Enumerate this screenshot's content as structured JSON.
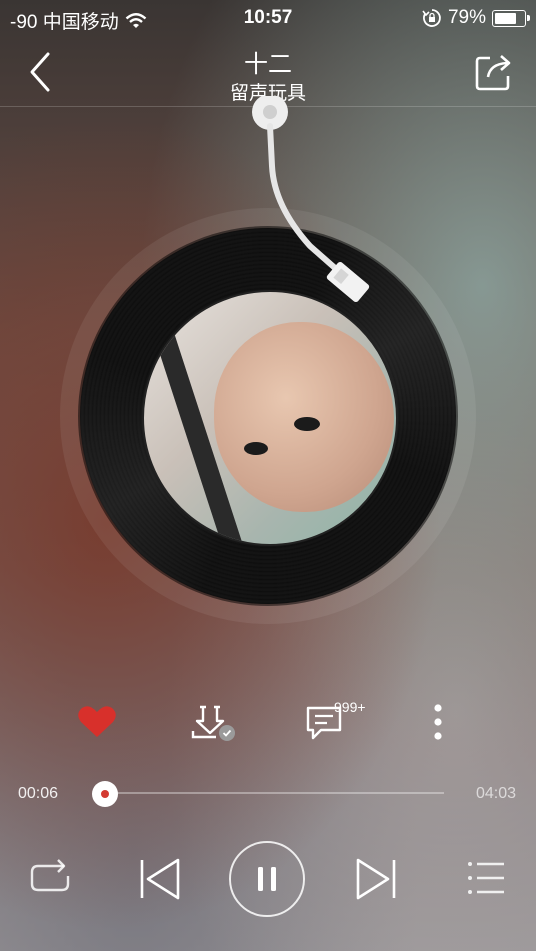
{
  "status_bar": {
    "carrier": "-90 中国移动",
    "time": "10:57",
    "battery_text": "79%",
    "battery_level": 0.79,
    "icons": [
      "wifi-icon",
      "rotation-lock-icon",
      "battery-icon"
    ]
  },
  "header": {
    "title": "十二",
    "artist": "留声玩具",
    "back_icon": "chevron-left-icon",
    "share_icon": "share-icon"
  },
  "player": {
    "album_art": "album-cover",
    "liked": true,
    "like_color": "#d8302b",
    "comment_count": "999+",
    "current_time": "00:06",
    "total_time": "04:03",
    "progress": 0.025,
    "state": "playing",
    "action_icons": [
      "heart-icon",
      "download-icon",
      "comment-icon",
      "more-icon"
    ],
    "control_icons": [
      "repeat-icon",
      "previous-icon",
      "pause-icon",
      "next-icon",
      "playlist-icon"
    ]
  }
}
